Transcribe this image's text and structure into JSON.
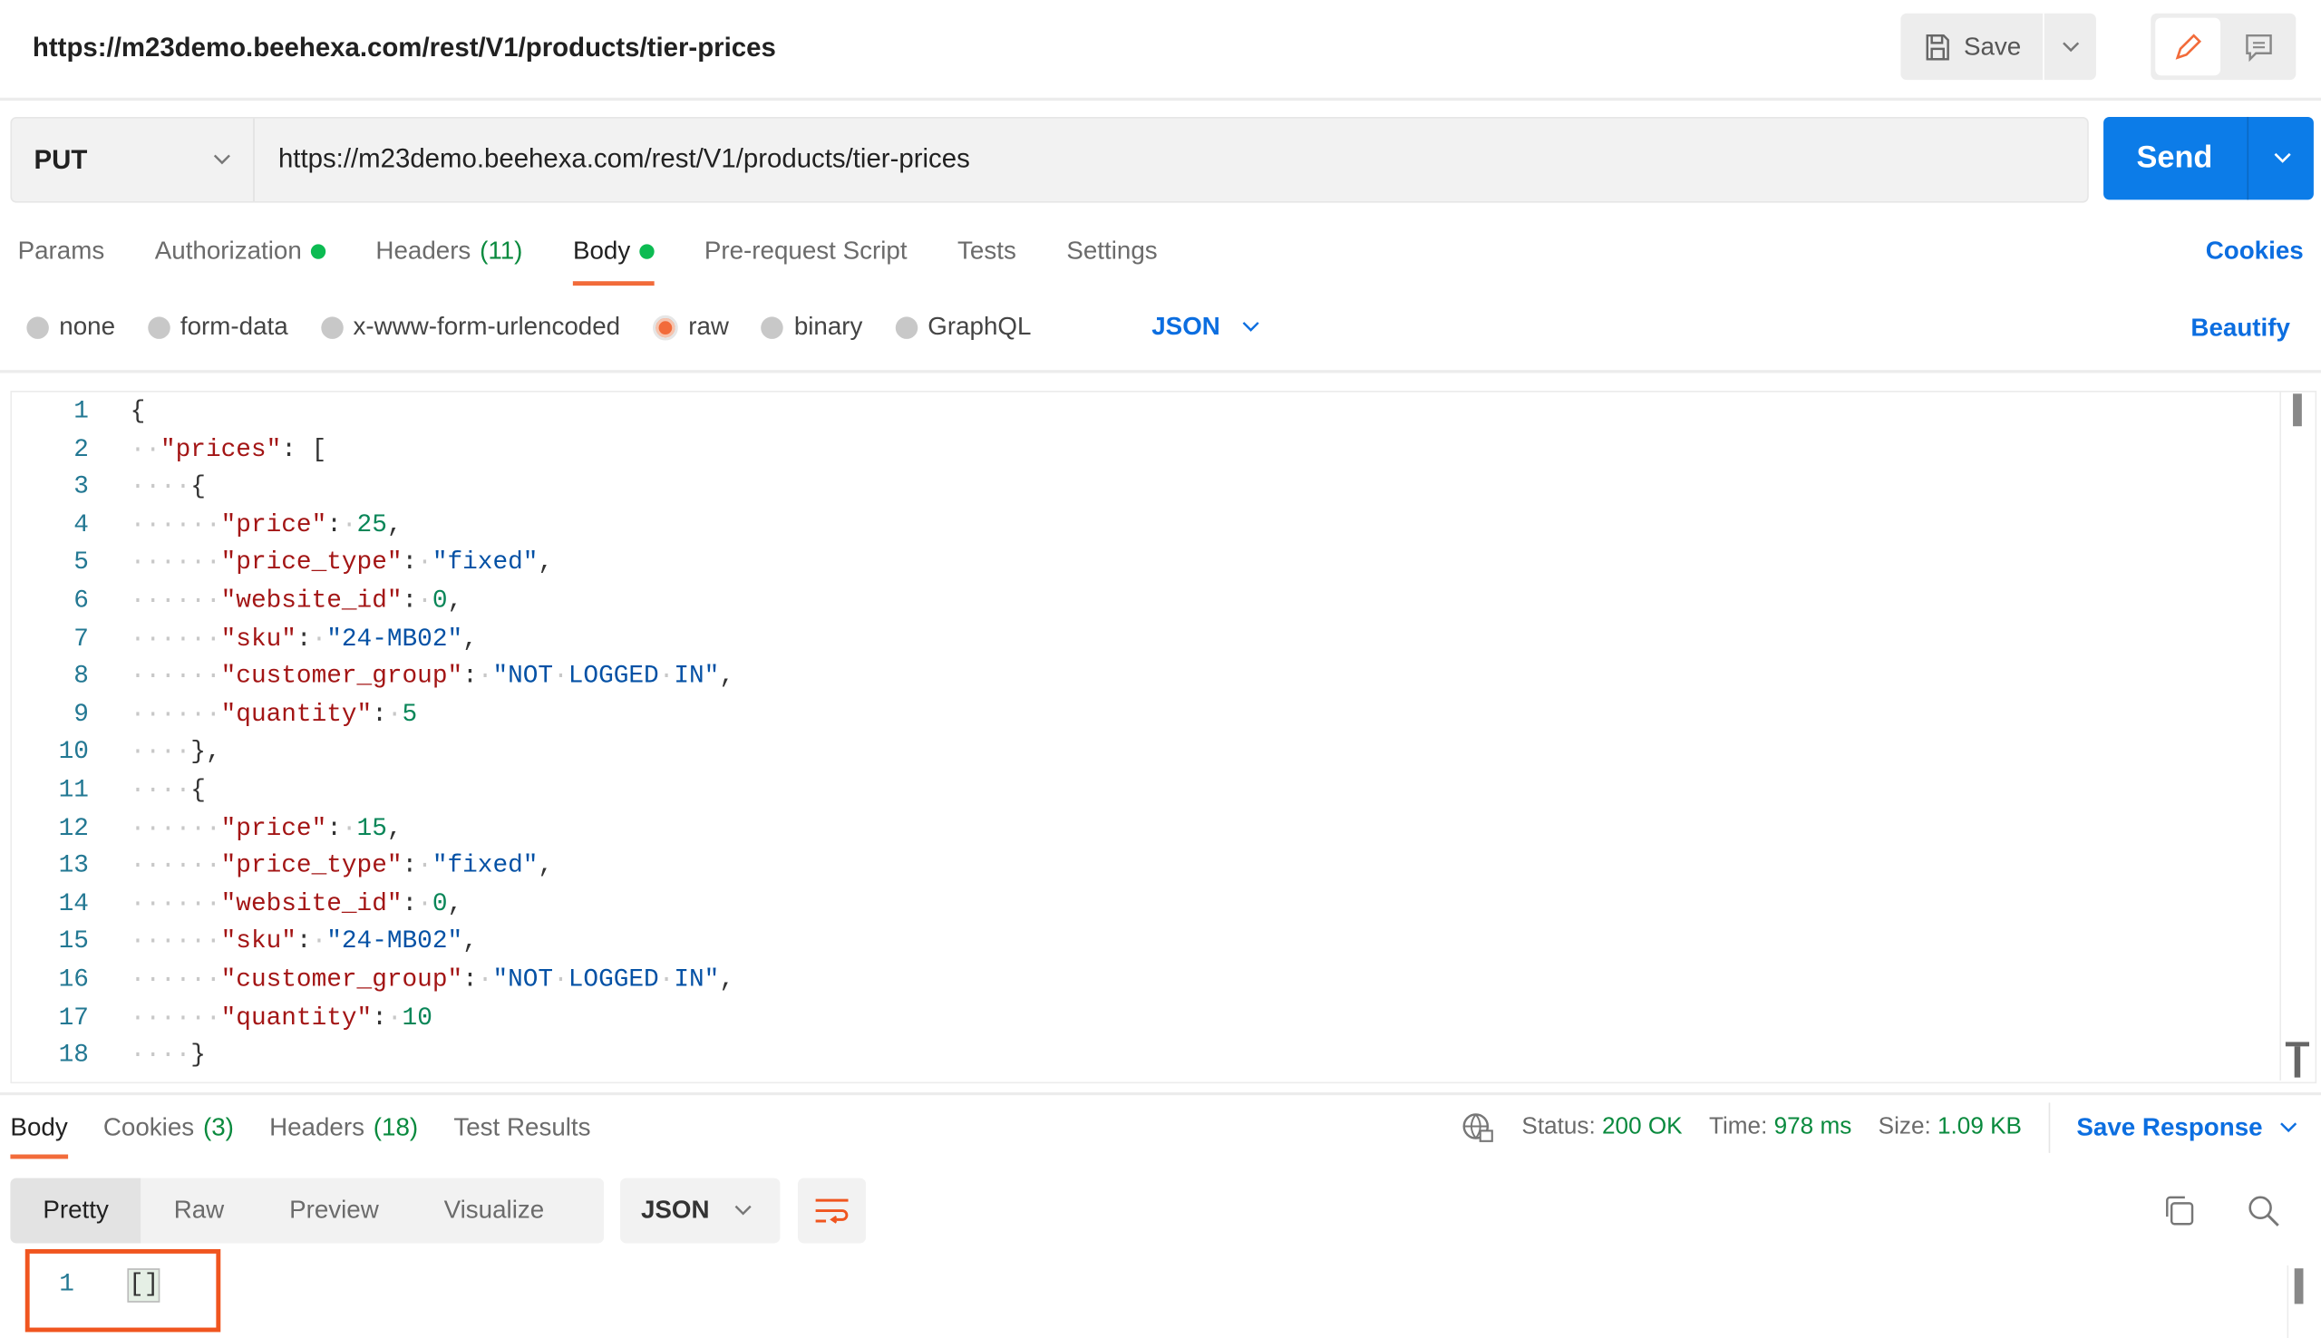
{
  "header": {
    "title": "https://m23demo.beehexa.com/rest/V1/products/tier-prices",
    "save_label": "Save"
  },
  "request": {
    "method": "PUT",
    "url": "https://m23demo.beehexa.com/rest/V1/products/tier-prices",
    "send_label": "Send"
  },
  "tabs": [
    {
      "label": "Params"
    },
    {
      "label": "Authorization",
      "dot": true
    },
    {
      "label": "Headers",
      "count": "(11)"
    },
    {
      "label": "Body",
      "dot": true,
      "active": true
    },
    {
      "label": "Pre-request Script"
    },
    {
      "label": "Tests"
    },
    {
      "label": "Settings"
    }
  ],
  "cookies_label": "Cookies",
  "body_modes": [
    "none",
    "form-data",
    "x-www-form-urlencoded",
    "raw",
    "binary",
    "GraphQL"
  ],
  "selected_body_mode": "raw",
  "body_format": "JSON",
  "beautify_label": "Beautify",
  "code_lines": [
    "{",
    "  \"prices\": [",
    "    {",
    "      \"price\": 25,",
    "      \"price_type\": \"fixed\",",
    "      \"website_id\": 0,",
    "      \"sku\": \"24-MB02\",",
    "      \"customer_group\": \"NOT LOGGED IN\",",
    "      \"quantity\": 5",
    "    },",
    "    {",
    "      \"price\": 15,",
    "      \"price_type\": \"fixed\",",
    "      \"website_id\": 0,",
    "      \"sku\": \"24-MB02\",",
    "      \"customer_group\": \"NOT LOGGED IN\",",
    "      \"quantity\": 10",
    "    }"
  ],
  "response": {
    "tabs": [
      {
        "label": "Body",
        "active": true
      },
      {
        "label": "Cookies",
        "count": "(3)"
      },
      {
        "label": "Headers",
        "count": "(18)"
      },
      {
        "label": "Test Results"
      }
    ],
    "status_label": "Status:",
    "status": "200 OK",
    "time_label": "Time:",
    "time": "978 ms",
    "size_label": "Size:",
    "size": "1.09 KB",
    "save_response_label": "Save Response",
    "views": [
      "Pretty",
      "Raw",
      "Preview",
      "Visualize"
    ],
    "format": "JSON",
    "line_number": "1",
    "body": "[]"
  },
  "colors": {
    "accent": "#f26b3a",
    "primary": "#0c7ce8",
    "success": "#0cbb52",
    "highlight_box": "#f0551f"
  }
}
